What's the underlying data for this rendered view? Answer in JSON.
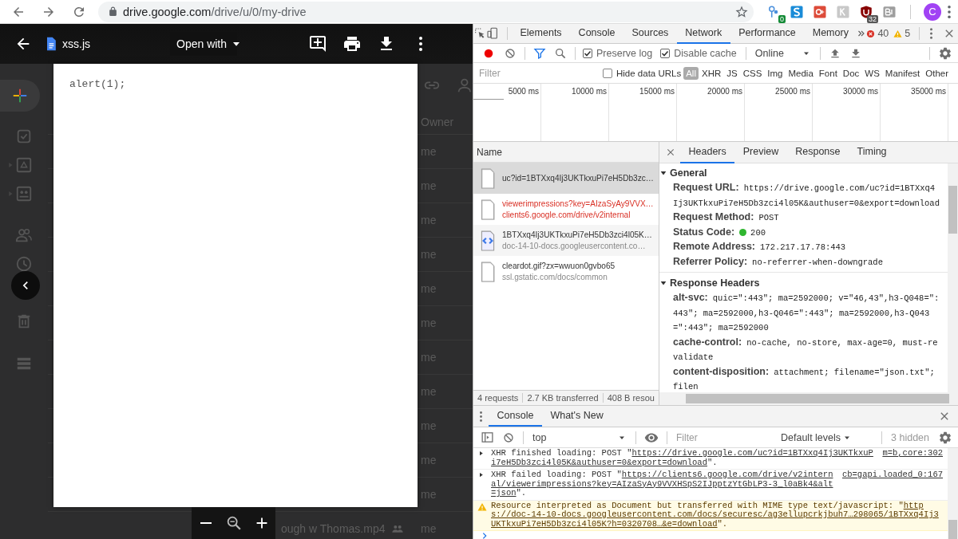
{
  "browser": {
    "address": {
      "domain": "drive.google.com",
      "path": "/drive/u/0/my-drive"
    },
    "extensions": [
      {
        "kind": "pin",
        "badge": "0"
      },
      {
        "kind": "blue-square"
      },
      {
        "kind": "red-square"
      },
      {
        "kind": "gray-square"
      },
      {
        "kind": "shield",
        "badge": "32"
      },
      {
        "kind": "gray-box"
      }
    ],
    "profile": "C"
  },
  "drive": {
    "owner_header": "Owner",
    "rows": [
      {
        "owner": "me"
      },
      {
        "owner": "me"
      },
      {
        "owner": "me"
      },
      {
        "owner": "me"
      },
      {
        "owner": "me"
      },
      {
        "owner": "me"
      },
      {
        "owner": "me"
      },
      {
        "owner": "me"
      },
      {
        "owner": "me"
      },
      {
        "owner": "me"
      },
      {
        "owner": "me"
      },
      {
        "owner": "me",
        "name": "ough w Thomas.mp4"
      }
    ]
  },
  "viewer": {
    "file_name": "xss.js",
    "open_with": "Open with",
    "content": "alert(1);"
  },
  "devtools": {
    "tabs": [
      {
        "label": "Elements",
        "selected": false
      },
      {
        "label": "Console",
        "selected": false
      },
      {
        "label": "Sources",
        "selected": false
      },
      {
        "label": "Network",
        "selected": true
      },
      {
        "label": "Performance",
        "selected": false
      },
      {
        "label": "Memory",
        "selected": false
      }
    ],
    "errors": "40",
    "warnings": "5",
    "toolbar": {
      "recording": true,
      "filter_active": true,
      "options": [
        {
          "label": "Preserve log",
          "checked": true
        },
        {
          "label": "Disable cache",
          "checked": true
        }
      ],
      "throttling": "Online"
    },
    "filter_bar": {
      "placeholder": "Filter",
      "hide_data_urls": {
        "label": "Hide data URLs",
        "checked": false
      },
      "types": [
        {
          "label": "All",
          "selected": true
        },
        {
          "label": "XHR",
          "selected": false
        },
        {
          "label": "JS",
          "selected": false
        },
        {
          "label": "CSS",
          "selected": false
        },
        {
          "label": "Img",
          "selected": false
        },
        {
          "label": "Media",
          "selected": false
        },
        {
          "label": "Font",
          "selected": false
        },
        {
          "label": "Doc",
          "selected": false
        },
        {
          "label": "WS",
          "selected": false
        },
        {
          "label": "Manifest",
          "selected": false
        },
        {
          "label": "Other",
          "selected": false
        }
      ]
    },
    "timeline": {
      "ticks": [
        "5000 ms",
        "10000 ms",
        "15000 ms",
        "20000 ms",
        "25000 ms",
        "30000 ms",
        "35000 ms"
      ]
    },
    "requests": {
      "header": "Name",
      "items": [
        {
          "kind": "document",
          "name": "uc?id=1BTXxq4Ij3UKTkxuPi7eH5Db3zc…",
          "selected": true,
          "failed": false
        },
        {
          "kind": "document",
          "name": "viewerimpressions?key=AIzaSyAy9VVX…",
          "domain": "clients6.google.com/drive/v2internal",
          "selected": false,
          "failed": true
        },
        {
          "kind": "script",
          "name": "1BTXxq4Ij3UKTkxuPi7eH5Db3zci4l05K…",
          "domain": "doc-14-10-docs.googleusercontent.co…",
          "selected": false,
          "failed": false
        },
        {
          "kind": "document",
          "name": "cleardot.gif?zx=wwuon0gvbo65",
          "domain": "ssl.gstatic.com/docs/common",
          "selected": false,
          "failed": false
        }
      ]
    },
    "summary": [
      "4 requests",
      "2.7 KB transferred",
      "408 B resou"
    ],
    "details": {
      "tabs": [
        {
          "label": "Headers",
          "selected": true
        },
        {
          "label": "Preview",
          "selected": false
        },
        {
          "label": "Response",
          "selected": false
        },
        {
          "label": "Timing",
          "selected": false
        }
      ],
      "sections": [
        {
          "title": "General",
          "expanded": true,
          "headers": [
            {
              "name": "Request URL:",
              "value": "https://drive.google.com/uc?id=1BTXxq4Ij3UKTkxuPi7eH5Db3zci4l05K&authuser=0&export=download"
            },
            {
              "name": "Request Method:",
              "value": "POST"
            },
            {
              "name": "Status Code:",
              "value": "200",
              "color": "#2fb62f"
            },
            {
              "name": "Remote Address:",
              "value": "172.217.17.78:443"
            },
            {
              "name": "Referrer Policy:",
              "value": "no-referrer-when-downgrade"
            }
          ]
        },
        {
          "title": "Response Headers",
          "expanded": true,
          "headers": [
            {
              "name": "alt-svc:",
              "value": "quic=\":443\"; ma=2592000; v=\"46,43\",h3-Q048=\":443\"; ma=2592000,h3-Q046=\":443\"; ma=2592000,h3-Q043=\":443\"; ma=2592000"
            },
            {
              "name": "cache-control:",
              "value": "no-cache, no-store, max-age=0, must-revalidate"
            },
            {
              "name": "content-disposition:",
              "value": "attachment; filename=\"json.txt\"; filen"
            }
          ]
        }
      ]
    },
    "drawer": {
      "tabs": [
        {
          "label": "Console",
          "selected": true
        },
        {
          "label": "What's New",
          "selected": false
        }
      ],
      "context": "top",
      "filter_placeholder": "Filter",
      "levels": "Default levels",
      "hidden": "3 hidden",
      "messages": [
        {
          "kind": "xhr",
          "prefix": "XHR finished loading: POST \"",
          "url": "https://drive.google.com/uc?id=1BTXxq4Ij3UKTkxuPi7eH5Db3zci4l05K&authuser=0&export=download",
          "suffix": "\".",
          "source": "m=b,core:302"
        },
        {
          "kind": "xhr",
          "prefix": "XHR failed loading: POST \"",
          "url": "https://clients6.google.com/drive/v2internal/viewerimpressions?key=AIzaSyAy9VVXHSpS2IJpptzYtGbLP3-3_l0aBk4&alt=json",
          "suffix": "\".",
          "source": "cb=gapi.loaded_0:167"
        },
        {
          "kind": "warning",
          "prefix": "Resource interpreted as Document but transferred with MIME type text/javascript: \"",
          "url": "https://doc-14-10-docs.googleusercontent.com/docs/securesc/ag3ellupcrkjbuh7…298065/1BTXxq4Ij3UKTkxuPi7eH5Db3zci4l05K?h=0320708…&e=download",
          "suffix": "\"."
        }
      ]
    }
  }
}
